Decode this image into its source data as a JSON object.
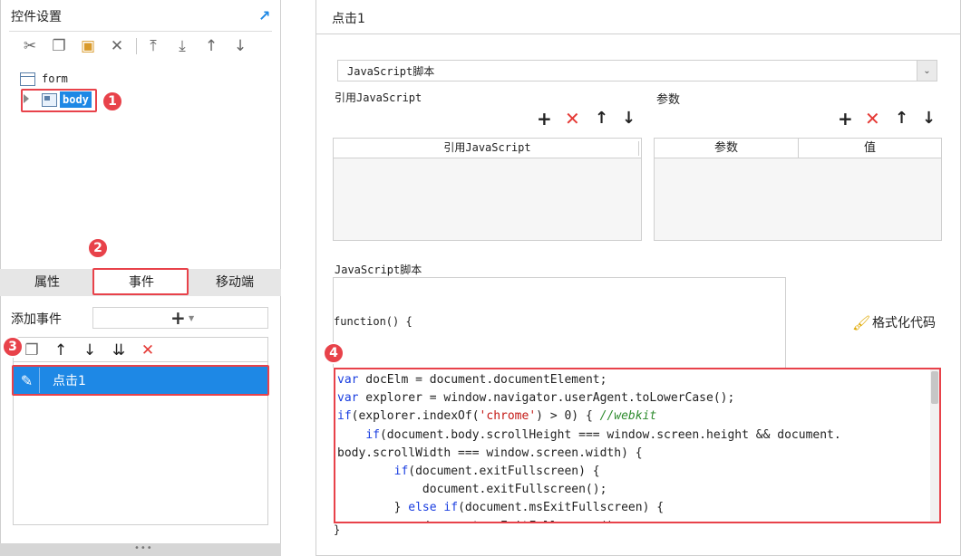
{
  "left": {
    "title": "控件设置",
    "tree": {
      "form": "form",
      "body": "body"
    },
    "tabs": [
      "属性",
      "事件",
      "移动端"
    ],
    "add_event_label": "添加事件",
    "event_item": "点击1",
    "badges": [
      "1",
      "2",
      "3",
      "4"
    ]
  },
  "right": {
    "title": "点击1",
    "script_type": "JavaScript脚本",
    "ref_js_label": "引用JavaScript",
    "params_label": "参数",
    "ref_js_col": "引用JavaScript",
    "param_col": "参数",
    "value_col": "值",
    "script_label": "JavaScript脚本",
    "func_line": "function() {",
    "format_label": "格式化代码",
    "closing": "}"
  },
  "colors": {
    "accent": "#1e88e5",
    "highlight": "#e8424a"
  }
}
